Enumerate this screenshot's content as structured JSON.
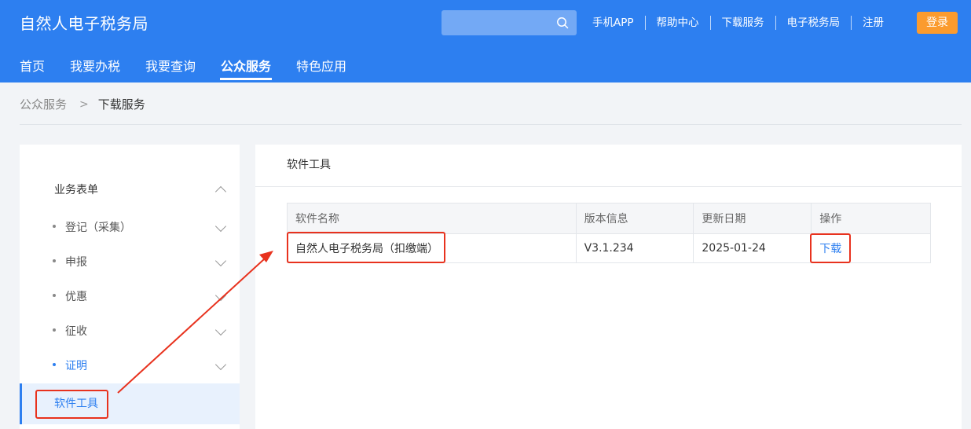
{
  "header": {
    "site_title": "自然人电子税务局",
    "search": {
      "placeholder": "",
      "value": ""
    },
    "links": [
      {
        "label": "手机APP"
      },
      {
        "label": "帮助中心"
      },
      {
        "label": "下载服务"
      },
      {
        "label": "电子税务局"
      },
      {
        "label": "注册"
      }
    ],
    "login_label": "登录"
  },
  "nav": {
    "tabs": [
      {
        "label": "首页"
      },
      {
        "label": "我要办税"
      },
      {
        "label": "我要查询"
      },
      {
        "label": "公众服务",
        "active": true
      },
      {
        "label": "特色应用"
      }
    ]
  },
  "breadcrumb": {
    "parent": "公众服务",
    "current": "下载服务"
  },
  "sidebar": {
    "group_label": "业务表单",
    "items": [
      {
        "label": "登记（采集）"
      },
      {
        "label": "申报"
      },
      {
        "label": "优惠"
      },
      {
        "label": "征收"
      },
      {
        "label": "证明"
      }
    ],
    "active_item": "软件工具"
  },
  "main": {
    "title": "软件工具",
    "table": {
      "headers": [
        "软件名称",
        "版本信息",
        "更新日期",
        "操作"
      ],
      "rows": [
        {
          "name": "自然人电子税务局（扣缴端）",
          "version": "V3.1.234",
          "date": "2025-01-24",
          "action": "下载"
        }
      ]
    }
  },
  "colors": {
    "header_blue": "#2d7ff0",
    "login_orange": "#fb9b2e",
    "annotation_red": "#e8321e"
  }
}
